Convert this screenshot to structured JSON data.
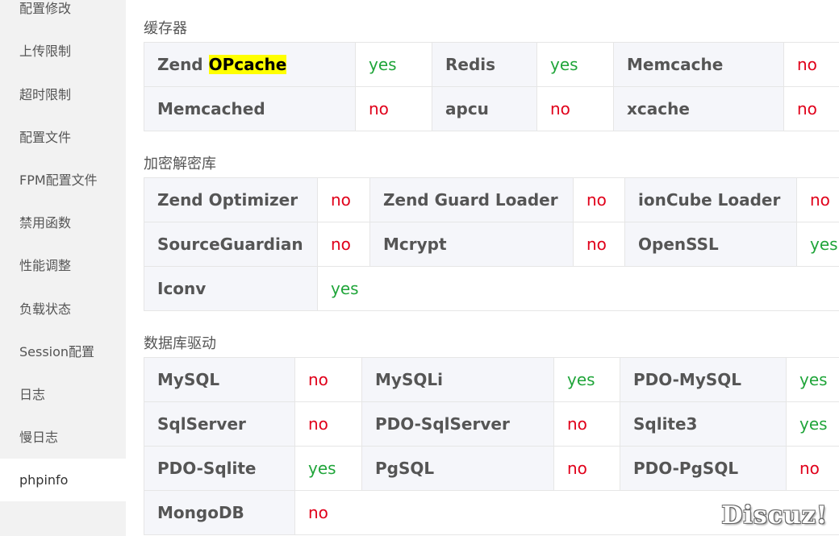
{
  "sidebar": {
    "items": [
      {
        "label": "配置修改"
      },
      {
        "label": "上传限制"
      },
      {
        "label": "超时限制"
      },
      {
        "label": "配置文件"
      },
      {
        "label": "FPM配置文件"
      },
      {
        "label": "禁用函数"
      },
      {
        "label": "性能调整"
      },
      {
        "label": "负载状态"
      },
      {
        "label": "Session配置"
      },
      {
        "label": "日志"
      },
      {
        "label": "慢日志"
      },
      {
        "label": "phpinfo"
      }
    ],
    "active": "phpinfo"
  },
  "sections": {
    "cache": {
      "title": "缓存器",
      "rows": [
        [
          {
            "name_prefix": "Zend ",
            "name_highlight": "OPcache",
            "value": "yes"
          },
          {
            "name": "Redis",
            "value": "yes"
          },
          {
            "name": "Memcache",
            "value": "no"
          }
        ],
        [
          {
            "name": "Memcached",
            "value": "no"
          },
          {
            "name": "apcu",
            "value": "no"
          },
          {
            "name": "xcache",
            "value": "no"
          }
        ]
      ]
    },
    "crypto": {
      "title": "加密解密库",
      "rows": [
        [
          {
            "name": "Zend Optimizer",
            "value": "no"
          },
          {
            "name": "Zend Guard Loader",
            "value": "no"
          },
          {
            "name": "ionCube Loader",
            "value": "no"
          }
        ],
        [
          {
            "name": "SourceGuardian",
            "value": "no"
          },
          {
            "name": "Mcrypt",
            "value": "no"
          },
          {
            "name": "OpenSSL",
            "value": "yes"
          }
        ],
        [
          {
            "name": "Iconv",
            "value": "yes"
          }
        ]
      ]
    },
    "db": {
      "title": "数据库驱动",
      "rows": [
        [
          {
            "name": "MySQL",
            "value": "no"
          },
          {
            "name": "MySQLi",
            "value": "yes"
          },
          {
            "name": "PDO-MySQL",
            "value": "yes"
          }
        ],
        [
          {
            "name": "SqlServer",
            "value": "no"
          },
          {
            "name": "PDO-SqlServer",
            "value": "no"
          },
          {
            "name": "Sqlite3",
            "value": "yes"
          }
        ],
        [
          {
            "name": "PDO-Sqlite",
            "value": "yes"
          },
          {
            "name": "PgSQL",
            "value": "no"
          },
          {
            "name": "PDO-PgSQL",
            "value": "no"
          }
        ],
        [
          {
            "name": "MongoDB",
            "value": "no"
          }
        ]
      ]
    }
  },
  "watermark": "Discuz!",
  "colors": {
    "yes": "#20a53a",
    "no": "#e0001a",
    "highlight": "#ffff00"
  }
}
